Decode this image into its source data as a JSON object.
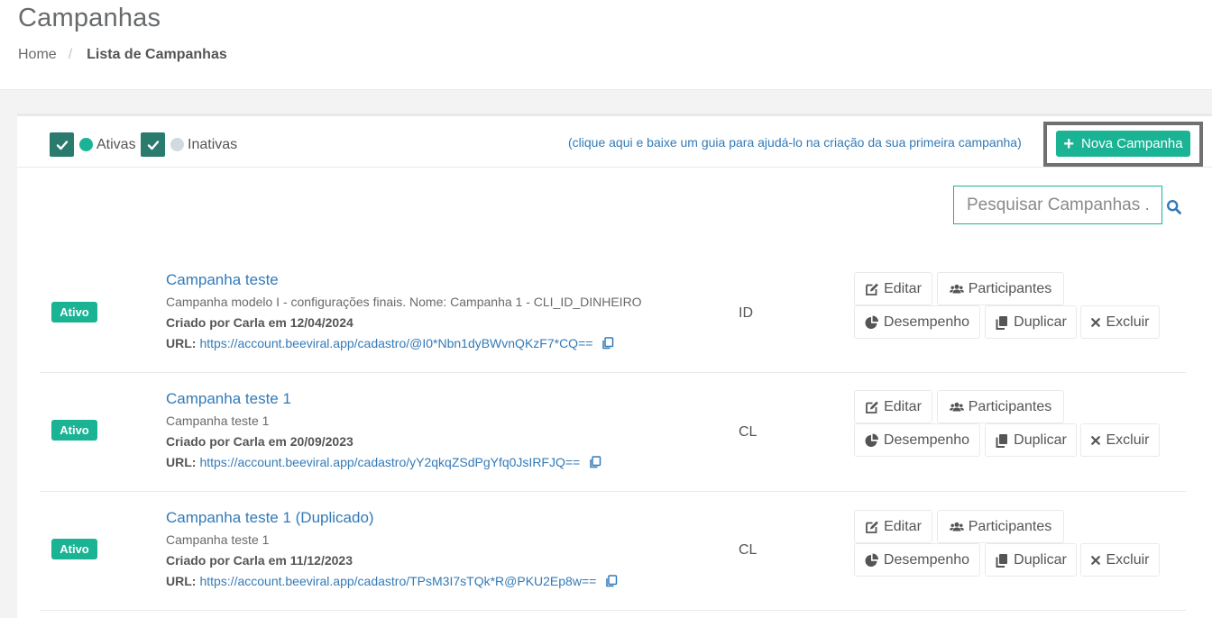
{
  "header": {
    "title": "Campanhas",
    "breadcrumb": {
      "home": "Home",
      "separator": "/",
      "current": "Lista de Campanhas"
    }
  },
  "filters": {
    "active": {
      "label": "Ativas",
      "checked": true,
      "color": "#1ab394"
    },
    "inactive": {
      "label": "Inativas",
      "checked": true,
      "color": "#d1dade"
    }
  },
  "toolbar": {
    "guide_link": "(clique aqui e baixe um guia para ajudá-lo na criação da sua primeira campanha)",
    "new_button": {
      "icon": "plus-icon",
      "label": "Nova Campanha"
    }
  },
  "search": {
    "placeholder": "Pesquisar Campanhas ..",
    "icon": "search-icon"
  },
  "colors": {
    "accent": "#1ab394",
    "link": "#337ab7",
    "checkbox": "#2a7a6e"
  },
  "actions": {
    "edit": "Editar",
    "participants": "Participantes",
    "performance": "Desempenho",
    "duplicate": "Duplicar",
    "delete": "Excluir"
  },
  "url_label": "URL:",
  "campaigns": [
    {
      "status": "Ativo",
      "name": "Campanha teste",
      "description": "Campanha modelo I - configurações finais. Nome: Campanha 1 - CLI_ID_DINHEIRO",
      "created": "Criado por Carla em 12/04/2024",
      "url": "https://account.beeviral.app/cadastro/@I0*Nbn1dyBWvnQKzF7*CQ==",
      "code": "ID"
    },
    {
      "status": "Ativo",
      "name": "Campanha teste 1",
      "description": "Campanha teste 1",
      "created": "Criado por Carla em 20/09/2023",
      "url": "https://account.beeviral.app/cadastro/yY2qkqZSdPgYfq0JsIRFJQ==",
      "code": "CL"
    },
    {
      "status": "Ativo",
      "name": "Campanha teste 1 (Duplicado)",
      "description": "Campanha teste 1",
      "created": "Criado por Carla em 11/12/2023",
      "url": "https://account.beeviral.app/cadastro/TPsM3I7sTQk*R@PKU2Ep8w==",
      "code": "CL"
    }
  ]
}
